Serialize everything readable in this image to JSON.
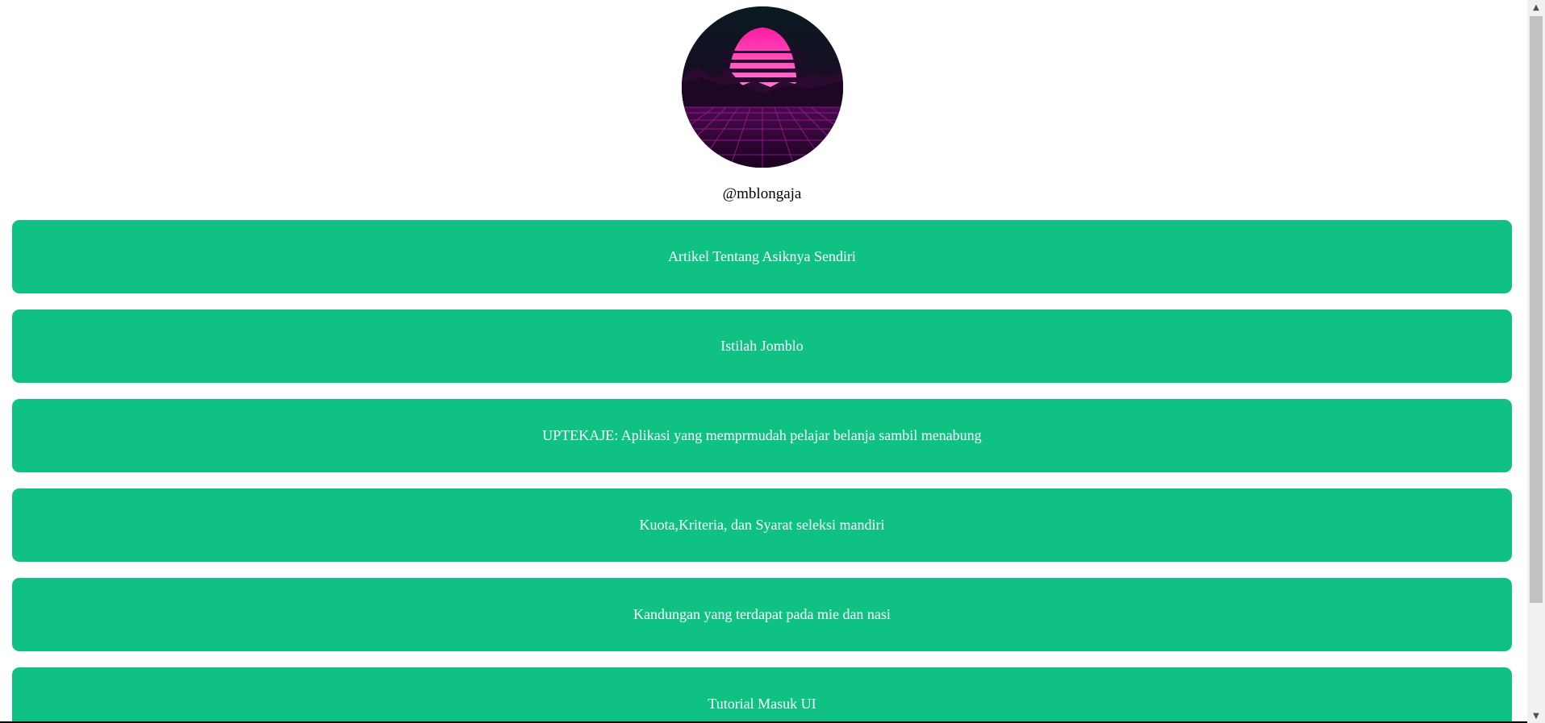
{
  "profile": {
    "username": "@mblongaja",
    "avatar_icon": "retro-synthwave-sunset-avatar"
  },
  "links": [
    {
      "label": "Artikel Tentang Asiknya Sendiri"
    },
    {
      "label": "Istilah Jomblo"
    },
    {
      "label": "UPTEKAJE: Aplikasi yang memprmudah pelajar belanja sambil menabung"
    },
    {
      "label": "Kuota,Kriteria, dan Syarat seleksi mandiri"
    },
    {
      "label": "Kandungan yang terdapat pada mie dan nasi"
    },
    {
      "label": "Tutorial Masuk UI"
    }
  ],
  "colors": {
    "button_bg": "#10c184",
    "button_text": "#ffffff",
    "page_bg": "#ffffff"
  },
  "scrollbar": {
    "up_icon": "triangle-up-icon",
    "down_icon": "triangle-down-icon"
  }
}
